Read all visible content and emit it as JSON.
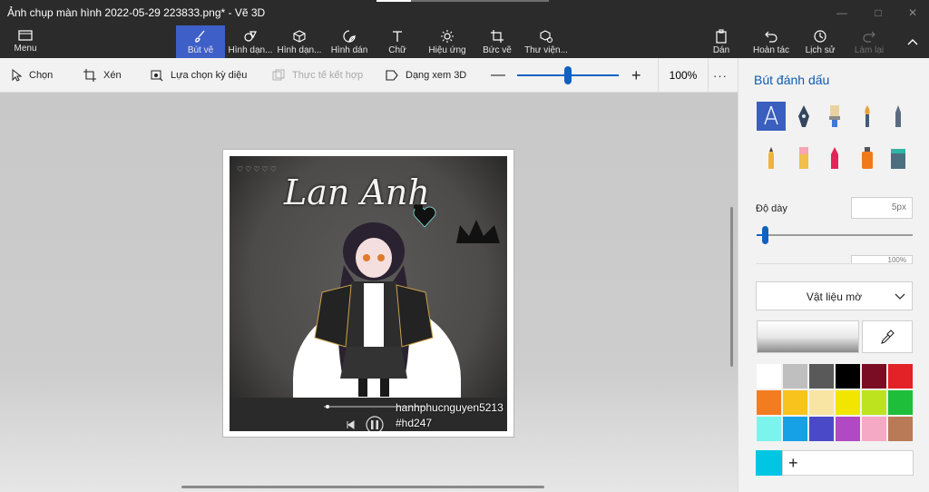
{
  "window": {
    "title": "Ảnh chụp màn hình 2022-05-29 223833.png* - Vẽ 3D",
    "progress": 0.2
  },
  "ribbon": {
    "menu": "Menu",
    "tools": [
      {
        "label": "Bút vẽ",
        "icon": "brush-icon",
        "active": true
      },
      {
        "label": "Hình dạn...",
        "icon": "2d-shapes-icon"
      },
      {
        "label": "Hình dạn...",
        "icon": "3d-shapes-icon"
      },
      {
        "label": "Hình dán",
        "icon": "stickers-icon"
      },
      {
        "label": "Chữ",
        "icon": "text-icon"
      },
      {
        "label": "Hiệu ứng",
        "icon": "effects-icon"
      },
      {
        "label": "Bức vẽ",
        "icon": "canvas-icon"
      },
      {
        "label": "Thư viện...",
        "icon": "library-icon"
      }
    ],
    "right": [
      {
        "label": "Dán",
        "icon": "paste-icon"
      },
      {
        "label": "Hoàn tác",
        "icon": "undo-icon"
      },
      {
        "label": "Lịch sử",
        "icon": "history-icon"
      },
      {
        "label": "Làm lại",
        "icon": "redo-icon",
        "disabled": true
      }
    ]
  },
  "commands": {
    "select": "Chọn",
    "crop": "Xén",
    "magic_select": "Lựa chọn kỳ diệu",
    "mixed_reality": "Thực tế kết hợp",
    "view_3d": "Dạng xem 3D",
    "zoom": "100%",
    "zoom_level": 0.5,
    "more": "···"
  },
  "image": {
    "title": "Lan Anh",
    "watermark_user": "hanhphucnguyen5213",
    "watermark_tag": "#hd247"
  },
  "panel": {
    "title": "Bút đánh dấu",
    "brushes": [
      "marker-icon",
      "calligraphy-pen-icon",
      "oil-brush-icon",
      "watercolor-icon",
      "pixel-pen-icon",
      "pencil-icon",
      "eraser-icon",
      "crayon-icon",
      "spray-can-icon",
      "fill-icon"
    ],
    "thickness_label": "Độ dày",
    "thickness_value": "5px",
    "thickness_level": 0.05,
    "opacity_value": "100%",
    "material": "Vật liệu mờ",
    "palette": [
      "#ffffff",
      "#bfbfbf",
      "#595959",
      "#000000",
      "#7a0d23",
      "#e32228",
      "#f47c20",
      "#f8c31c",
      "#f9e5a3",
      "#f2e600",
      "#bde31e",
      "#1ebe3b",
      "#7cf4ee",
      "#16a1e7",
      "#4a4ac8",
      "#b149c4",
      "#f6a9c4",
      "#b97a57"
    ],
    "current_color": "#00c6e4",
    "add_color": "+"
  }
}
